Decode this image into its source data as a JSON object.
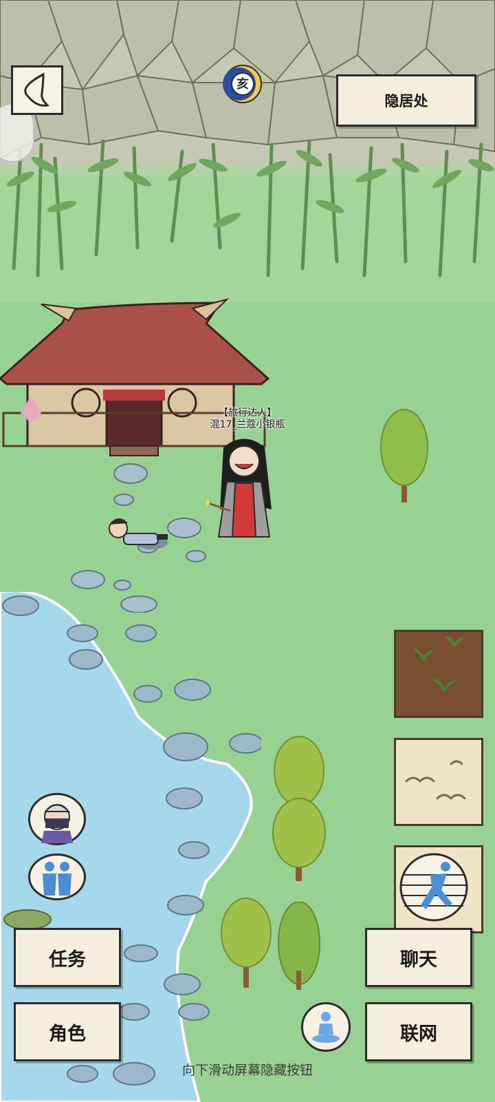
{
  "location": {
    "label": "隐居处"
  },
  "time_badge": {
    "glyph": "亥"
  },
  "player": {
    "title": "【旅行达人】",
    "name": "混17_兰蔻小银瓶"
  },
  "menu": {
    "quest": "任务",
    "character": "角色",
    "chat": "聊天",
    "network": "联网"
  },
  "hint": "向下滑动屏幕隐藏按钮",
  "colors": {
    "grass": "#98d293",
    "water": "#a6d8ec",
    "wall": "#c8cbb7",
    "button_bg": "#f4eedd"
  }
}
